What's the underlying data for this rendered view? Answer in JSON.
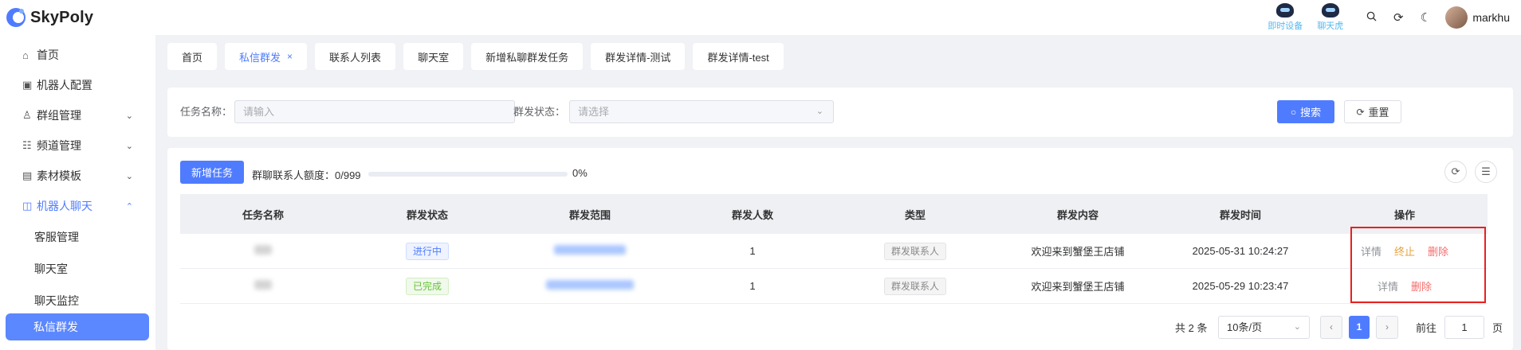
{
  "app": {
    "name": "SkyPoly"
  },
  "header": {
    "mascot1": "即时设备",
    "mascot2": "聊天虎",
    "username": "markhu"
  },
  "sidebar": {
    "items": [
      {
        "label": "首页",
        "icon": "home-icon"
      },
      {
        "label": "机器人配置",
        "icon": "robot-icon"
      },
      {
        "label": "群组管理",
        "icon": "users-icon"
      },
      {
        "label": "频道管理",
        "icon": "list-icon"
      },
      {
        "label": "素材模板",
        "icon": "image-icon"
      },
      {
        "label": "机器人聊天",
        "icon": "chat-robot-icon"
      }
    ],
    "subitems": [
      "客服管理",
      "聊天室",
      "聊天监控",
      "私信群发"
    ]
  },
  "tabs": [
    "首页",
    "私信群发",
    "联系人列表",
    "聊天室",
    "新增私聊群发任务",
    "群发详情-测试",
    "群发详情-test"
  ],
  "filter": {
    "task_label": "任务名称：",
    "task_placeholder": "请输入",
    "status_label": "群发状态：",
    "status_placeholder": "请选择",
    "search_label": "搜索",
    "reset_label": "重置"
  },
  "toolbar": {
    "new_task": "新增任务",
    "quota_label": "群聊联系人额度：0/999",
    "quota_progress": 0,
    "quota_percent": "0%"
  },
  "table": {
    "headers": [
      "任务名称",
      "群发状态",
      "群发范围",
      "群发人数",
      "类型",
      "群发内容",
      "群发时间",
      "操作"
    ],
    "rows": [
      {
        "status": "进行中",
        "count": "1",
        "type": "群发联系人",
        "content": "欢迎来到蟹堡王店铺",
        "time": "2025-05-31 10:24:27",
        "ops": [
          "详情",
          "终止",
          "删除"
        ]
      },
      {
        "status": "已完成",
        "count": "1",
        "type": "群发联系人",
        "content": "欢迎来到蟹堡王店铺",
        "time": "2025-05-29 10:23:47",
        "ops": [
          "详情",
          "删除"
        ]
      }
    ]
  },
  "pagination": {
    "total": "共 2 条",
    "page_size": "10条/页",
    "current": "1",
    "goto_label": "前往",
    "goto_value": "1",
    "page_suffix": "页"
  }
}
